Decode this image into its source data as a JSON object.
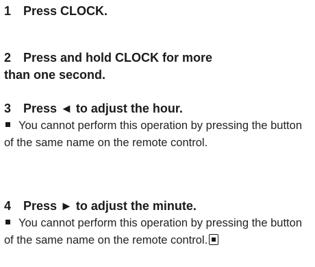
{
  "steps": [
    {
      "number": "1",
      "text": "Press CLOCK."
    },
    {
      "number": "2",
      "text": "Press and hold CLOCK for more than one second."
    },
    {
      "number": "3",
      "text": "Press ◄ to adjust the hour.",
      "note": "You cannot perform this operation by pressing the button of the same name on the remote control."
    },
    {
      "number": "4",
      "text": "Press ► to adjust the minute.",
      "note": "You cannot perform this operation by pressing the button of the same name on the remote control."
    }
  ],
  "icons": {
    "bullet": "square-bullet-icon",
    "end": "end-of-section-icon"
  }
}
